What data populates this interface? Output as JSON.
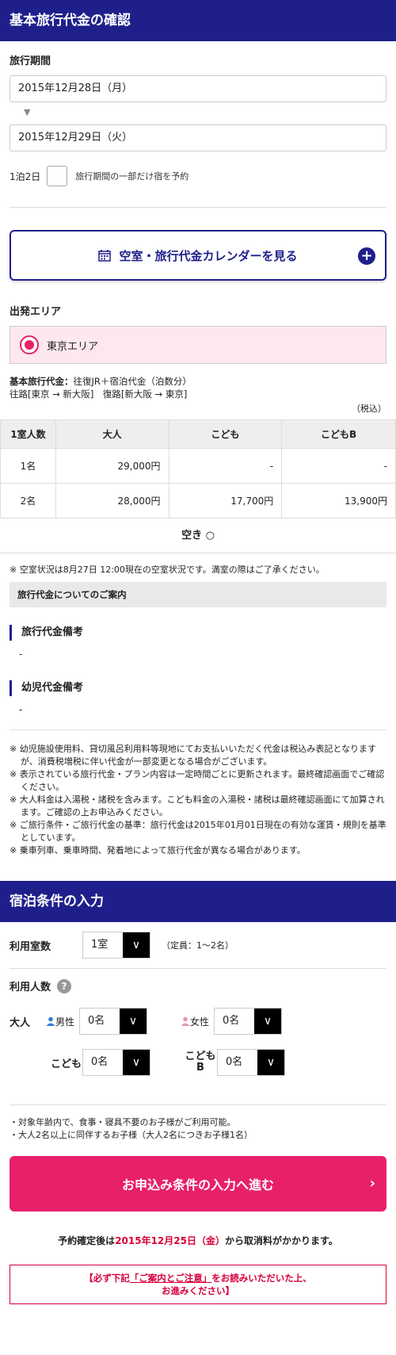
{
  "section1": {
    "title": "基本旅行代金の確認",
    "period_label": "旅行期間",
    "start_date": "2015年12月28日（月）",
    "end_date": "2015年12月29日（火）",
    "nights": "1泊2日",
    "partial_label": "旅行期間の一部だけ宿を予約",
    "calendar_button": "空室・旅行代金カレンダーを見る",
    "area_label": "出発エリア",
    "area_value": "東京エリア",
    "basic_label": "基本旅行代金：",
    "basic_desc": "往復JR＋宿泊代金（泊数分）",
    "route": "往路[東京 → 新大阪]　復路[新大阪 → 東京]",
    "tax_note": "（税込）"
  },
  "price_table": {
    "headers": [
      "1室人数",
      "大人",
      "こども",
      "こどもB"
    ],
    "rows": [
      [
        "1名",
        "29,000円",
        "-",
        "-"
      ],
      [
        "2名",
        "28,000円",
        "17,700円",
        "13,900円"
      ]
    ],
    "availability": "空き ○"
  },
  "vacancy_note": "※ 空室状況は8月27日 12:00現在の空室状況です。満室の際はご了承ください。",
  "info_head": "旅行代金についてのご案内",
  "remark1_title": "旅行代金備考",
  "remark1_value": "-",
  "remark2_title": "幼児代金備考",
  "remark2_value": "-",
  "notes": [
    "※ 幼児施設使用料、貸切風呂利用料等現地にてお支払いいただく代金は税込み表記となりますが、消費税増税に伴い代金が一部変更となる場合がございます。",
    "※ 表示されている旅行代金・プラン内容は一定時間ごとに更新されます。最終確認画面でご確認ください。",
    "※ 大人料金は入湯税・諸税を含みます。こども料金の入湯税・諸税は最終確認画面にて加算されます。ご確認の上お申込みください。",
    "※ ご旅行条件・ご旅行代金の基準：旅行代金は2015年01月01日現在の有効な運賃・規則を基準としています。",
    "※ 乗車列車、乗車時間、発着地によって旅行代金が異なる場合があります。"
  ],
  "section2": {
    "title": "宿泊条件の入力",
    "rooms_label": "利用室数",
    "rooms_value": "1室",
    "capacity": "（定員：1〜2名）",
    "people_label": "利用人数",
    "help": "?",
    "adult_label": "大人",
    "male_label": "男性",
    "male_value": "0名",
    "female_label": "女性",
    "female_value": "0名",
    "child_label": "こども",
    "child_value": "0名",
    "childb_label_1": "こども",
    "childb_label_2": "B",
    "childb_value": "0名",
    "conditions": [
      "・対象年齢内で、食事・寝具不要のお子様がご利用可能。",
      "・大人2名以上に同伴するお子様（大人2名につきお子様1名）"
    ],
    "apply_button": "お申込み条件の入力へ進む",
    "cancel_prefix": "予約確定後は",
    "cancel_date": "2015年12月25日（金）",
    "cancel_suffix": "から取消料がかかります。",
    "warn_prefix": "【必ず下記",
    "warn_link": "「ご案内とご注意」",
    "warn_suffix": "をお読みいただいた上、",
    "warn_line2": "お進みください】"
  },
  "colors": {
    "navy": "#1f1f8c",
    "pink": "#e8206a",
    "red": "#d7003a",
    "area_bg": "#fde8ee"
  }
}
